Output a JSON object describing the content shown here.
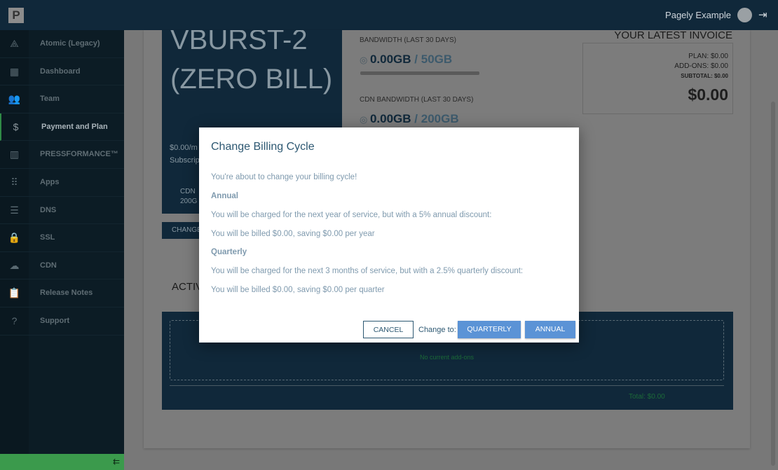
{
  "header": {
    "logo": "P",
    "user_name": "Pagely Example"
  },
  "sidebar": {
    "items": [
      {
        "label": "Atomic (Legacy)",
        "icon": "atomic-icon",
        "glyph": "⟁"
      },
      {
        "label": "Dashboard",
        "icon": "dashboard-icon",
        "glyph": "▦"
      },
      {
        "label": "Team",
        "icon": "team-icon",
        "glyph": "👥"
      },
      {
        "label": "Payment and Plan",
        "icon": "dollar-icon",
        "glyph": "$",
        "active": true
      },
      {
        "label": "PRESSFORMANCE™",
        "icon": "chart-icon",
        "glyph": "▥"
      },
      {
        "label": "Apps",
        "icon": "apps-grid-icon",
        "glyph": "⠿"
      },
      {
        "label": "DNS",
        "icon": "dns-icon",
        "glyph": "☰"
      },
      {
        "label": "SSL",
        "icon": "lock-icon",
        "glyph": "🔒"
      },
      {
        "label": "CDN",
        "icon": "cloud-icon",
        "glyph": "☁"
      },
      {
        "label": "Release Notes",
        "icon": "clipboard-icon",
        "glyph": "📋"
      },
      {
        "label": "Support",
        "icon": "help-icon",
        "glyph": "?"
      }
    ],
    "collapse_glyph": "⇇"
  },
  "plan": {
    "title": "VBURST-2 (ZERO BILL)",
    "price": "$0.00/m",
    "subscription": "Subscrip",
    "cdn": "CDN",
    "cdn_amount": "200G",
    "change_button": "CHANGE"
  },
  "bandwidth": {
    "label": "BANDWIDTH (LAST 30 DAYS)",
    "used": "0.00GB",
    "limit": "/ 50GB",
    "usage_fraction": 0
  },
  "cdn_bandwidth": {
    "label": "CDN BANDWIDTH (LAST 30 DAYS)",
    "used": "0.00GB",
    "limit": "/ 200GB"
  },
  "invoice": {
    "title": "YOUR LATEST INVOICE",
    "plan": "PLAN: $0.00",
    "addons": "ADD-ONS: $0.00",
    "subtotal": "SUBTOTAL: $0.00",
    "total": "$0.00"
  },
  "addons": {
    "heading": "ACTIV",
    "empty": "No current add-ons",
    "total": "Total: $0.00"
  },
  "modal": {
    "title": "Change Billing Cycle",
    "intro": "You're about to change your billing cycle!",
    "annual_heading": "Annual",
    "annual_desc": "You will be charged for the next year of service, but with a 5% annual discount:",
    "annual_bill": "You will be billed $0.00, saving $0.00 per year",
    "quarterly_heading": "Quarterly",
    "quarterly_desc": "You will be charged for the next 3 months of service, but with a 2.5% quarterly discount:",
    "quarterly_bill": "You will be billed $0.00, saving $0.00 per quarter",
    "cancel": "CANCEL",
    "change_to": "Change to:",
    "quarterly": "QUARTERLY",
    "annual": "ANNUAL"
  },
  "colors": {
    "primary_button": "#5b93d6",
    "header": "#10283a",
    "active_accent": "#2f8a46"
  }
}
